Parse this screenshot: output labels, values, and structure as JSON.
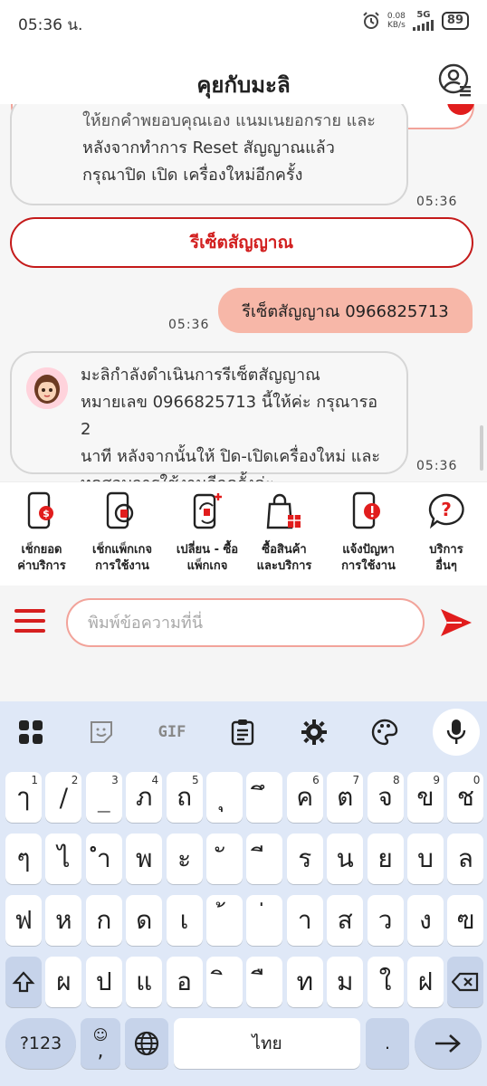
{
  "status": {
    "time": "05:36 น.",
    "net_speed": "0.08",
    "net_unit": "KB/s",
    "network": "5G",
    "battery": "89"
  },
  "header": {
    "title": "คุยกับมะลิ"
  },
  "chat": {
    "bot_msg1_line0": "ให้ยกคำพยอบคุณเอง แนมเนยอกราย และ",
    "bot_msg1_line1": "หลังจากทำการ Reset สัญญาณแล้ว",
    "bot_msg1_line2": "กรุณาปิด เปิด เครื่องใหม่อีกครั้ง",
    "ts1": "05:36",
    "reset_button": "รีเซ็ตสัญญาณ",
    "user_msg": "รีเซ็ตสัญญาณ 0966825713",
    "ts_user": "05:36",
    "bot_msg2_line0": "มะลิกำลังดำเนินการรีเซ็ตสัญญาณ",
    "bot_msg2_line1": "หมายเลข 0966825713 นี้ให้ค่ะ กรุณารอ 2",
    "bot_msg2_line2": "นาที หลังจากนั้นให้ ปิด-เปิดเครื่องใหม่ และ",
    "bot_msg2_line3": "ทดสอบการใช้งานอีกครั้งค่ะ",
    "ts2": "05:36"
  },
  "quickmenu": [
    {
      "label": "เช็กยอด\nค่าบริการ",
      "icon": "phone-bill-icon"
    },
    {
      "label": "เช็กแพ็กเกจ\nการใช้งาน",
      "icon": "phone-package-icon"
    },
    {
      "label": "เปลี่ยน - ซื้อ\nแพ็กเกจ",
      "icon": "phone-change-icon"
    },
    {
      "label": "ซื้อสินค้า\nและบริการ",
      "icon": "shopping-bag-icon"
    },
    {
      "label": "แจ้งปัญหา\nการใช้งาน",
      "icon": "phone-alert-icon"
    },
    {
      "label": "บริการ\nอื่นๆ",
      "icon": "question-bubble-icon"
    }
  ],
  "input": {
    "placeholder": "พิมพ์ข้อความที่นี่"
  },
  "keyboard": {
    "gif_label": "GIF",
    "row1": [
      [
        "ๅ",
        "1"
      ],
      [
        "/",
        "2"
      ],
      [
        "_",
        "3"
      ],
      [
        "ภ",
        "4"
      ],
      [
        "ถ",
        "5"
      ],
      [
        "ุ",
        ""
      ],
      [
        "ึ",
        ""
      ],
      [
        "ค",
        "6"
      ],
      [
        "ต",
        "7"
      ],
      [
        "จ",
        "8"
      ],
      [
        "ข",
        "9"
      ],
      [
        "ช",
        "0"
      ]
    ],
    "row2": [
      "ๆ",
      "ไ",
      "ำ",
      "พ",
      "ะ",
      "ั",
      "ี",
      "ร",
      "น",
      "ย",
      "บ",
      "ล"
    ],
    "row3": [
      "ฟ",
      "ห",
      "ก",
      "ด",
      "เ",
      "้",
      "่",
      "า",
      "ส",
      "ว",
      "ง",
      "ฃ"
    ],
    "row4": [
      "ผ",
      "ป",
      "แ",
      "อ",
      "ิ",
      "ื",
      "ท",
      "ม",
      "ใ",
      "ฝ"
    ],
    "sym_key": "?123",
    "comma_key": ",",
    "space_label": "ไทย",
    "period_key": "."
  },
  "colors": {
    "brand_red": "#d61f1f",
    "user_bubble": "#f7b7a8",
    "keyboard_bg": "#dfe8f7"
  }
}
